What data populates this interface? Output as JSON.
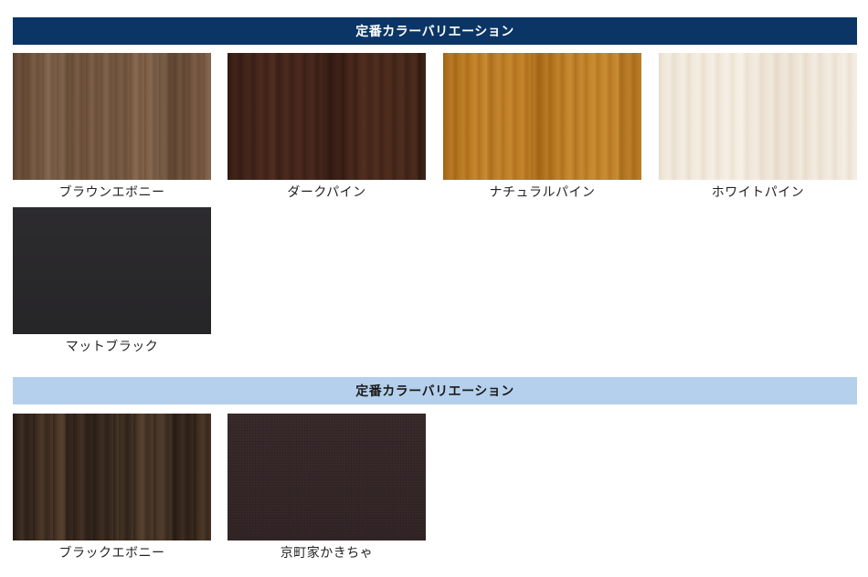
{
  "sections": {
    "standard": {
      "title": "定番カラーバリエーション",
      "color": "#0b3565",
      "items": [
        {
          "label": "ブラウンエボニー"
        },
        {
          "label": "ダークパイン"
        },
        {
          "label": "ナチュラルパイン"
        },
        {
          "label": "ホワイトパイン"
        },
        {
          "label": "マットブラック"
        }
      ]
    },
    "premium": {
      "title": "定番カラーバリエーション",
      "color": "#b5d0ec",
      "items": [
        {
          "label": "ブラックエボニー"
        },
        {
          "label": "京町家かきちゃ"
        }
      ]
    }
  }
}
